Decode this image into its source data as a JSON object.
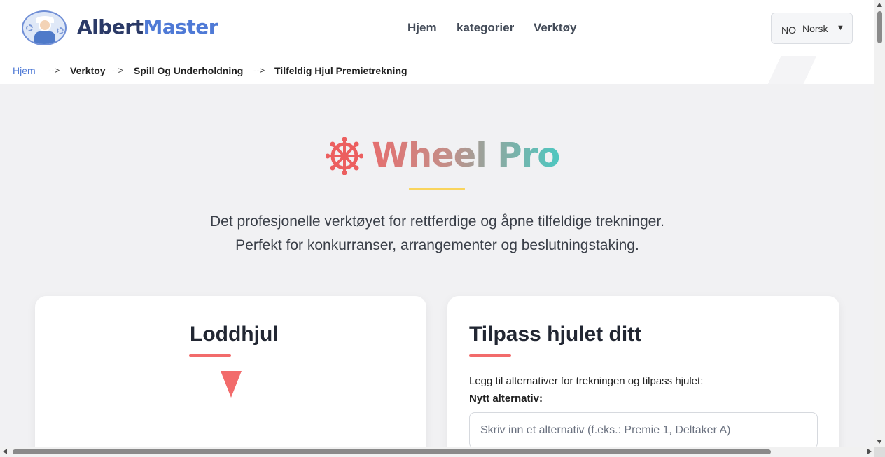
{
  "header": {
    "logo_part1": "Albert",
    "logo_part2": "Master",
    "nav": [
      "Hjem",
      "kategorier",
      "Verktøy"
    ],
    "language": {
      "code": "NO",
      "name": "Norsk",
      "caret": "▼"
    }
  },
  "breadcrumb": {
    "items": [
      "Hjem",
      "Verktoy",
      "Spill Og Underholdning",
      "Tilfeldig Hjul Premietrekning"
    ],
    "separator": "-->"
  },
  "hero": {
    "icon": "dharma-wheel-icon",
    "title": "Wheel Pro",
    "description_line1": "Det profesjonelle verktøyet for rettferdige og åpne tilfeldige trekninger.",
    "description_line2": "Perfekt for konkurranser, arrangementer og beslutningstaking."
  },
  "wheel_card": {
    "title": "Loddhjul"
  },
  "customize_card": {
    "title": "Tilpass hjulet ditt",
    "intro": "Legg til alternativer for trekningen og tilpass hjulet:",
    "new_option_label": "Nytt alternativ:",
    "new_option_placeholder": "Skriv inn et alternativ (f.eks.: Premie 1, Deltaker A)",
    "new_option_value": ""
  },
  "colors": {
    "brand_dark": "#2b3a67",
    "brand_blue": "#4f7ad6",
    "accent_red": "#f26b6b",
    "accent_yellow": "#f9d45c",
    "accent_teal": "#4ec7c0"
  }
}
